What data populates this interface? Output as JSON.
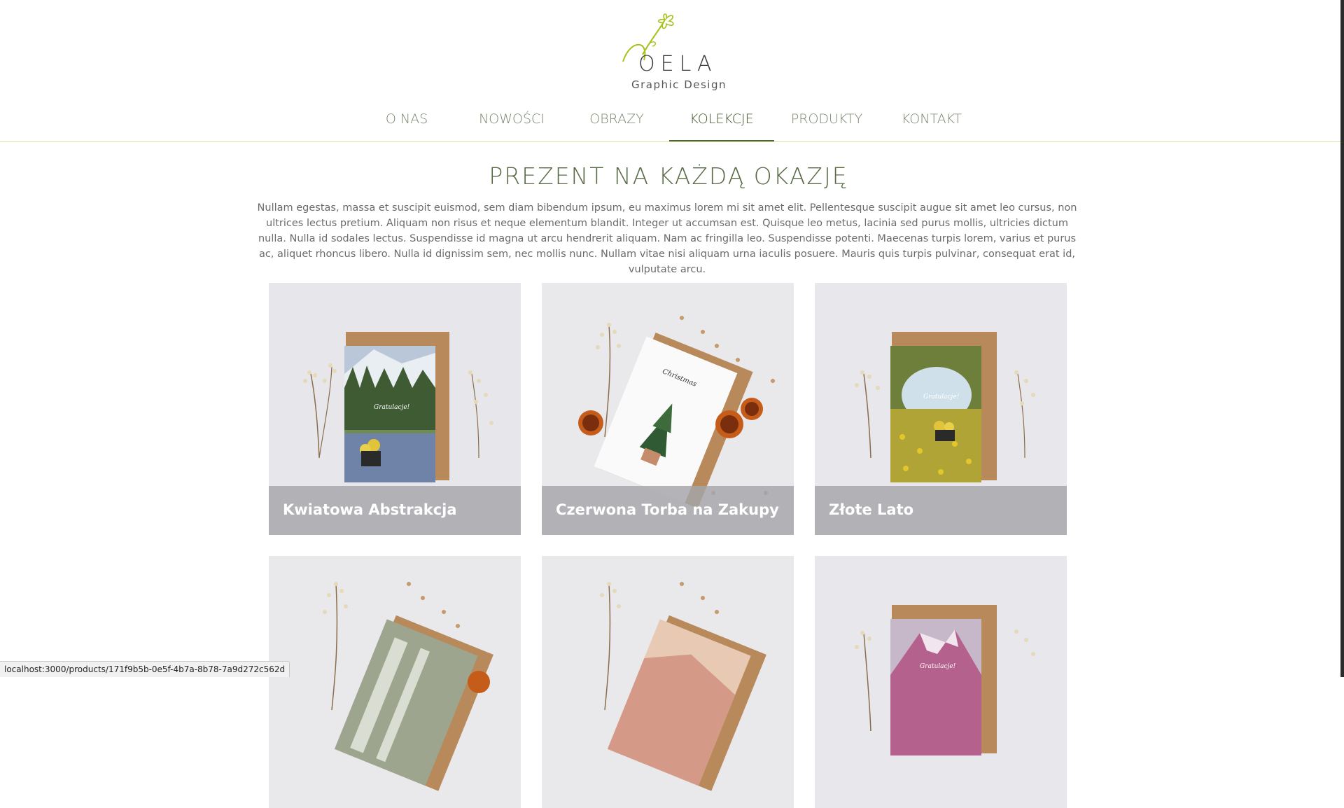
{
  "brand": {
    "wordmark": "OELA",
    "tagline": "Graphic Design",
    "accent": "#a5c21a"
  },
  "nav": {
    "items": [
      {
        "label": "O NAS",
        "active": false
      },
      {
        "label": "NOWOŚCI",
        "active": false
      },
      {
        "label": "OBRAZY",
        "active": false
      },
      {
        "label": "KOLEKCJE",
        "active": true
      },
      {
        "label": "PRODUKTY",
        "active": false
      },
      {
        "label": "KONTAKT",
        "active": false
      }
    ]
  },
  "main": {
    "title": "PREZENT NA KAŻDĄ OKAZJĘ",
    "intro": "Nullam egestas, massa et suscipit euismod, sem diam bibendum ipsum, eu maximus lorem mi sit amet elit. Pellentesque suscipit augue sit amet leo cursus, non ultrices lectus pretium. Aliquam non risus et neque elementum blandit. Integer ut accumsan est. Quisque leo metus, lacinia sed purus mollis, ultricies dictum nulla. Nulla id sodales lectus. Suspendisse id magna ut arcu hendrerit aliquam. Nam ac fringilla leo. Suspendisse potenti. Maecenas turpis lorem, varius et purus ac, aliquet rhoncus libero. Nulla id dignissim sem, nec mollis nunc. Nullam vitae nisi aliquam urna iaculis posuere. Mauris quis turpis pulvinar, consequat erat id, vulputate arcu.",
    "products": [
      {
        "name": "Kwiatowa Abstrakcja",
        "card_text": "Gratulacje!"
      },
      {
        "name": "Czerwona Torba na Zakupy",
        "card_text": "Christmas"
      },
      {
        "name": "Złote Lato",
        "card_text": "Gratulacje!"
      },
      {
        "name": "",
        "card_text": ""
      },
      {
        "name": "",
        "card_text": ""
      },
      {
        "name": "",
        "card_text": "Gratulacje!"
      }
    ]
  },
  "statusbar": {
    "url": "localhost:3000/products/171f9b5b-0e5f-4b7a-8b78-7a9d272c562d"
  }
}
